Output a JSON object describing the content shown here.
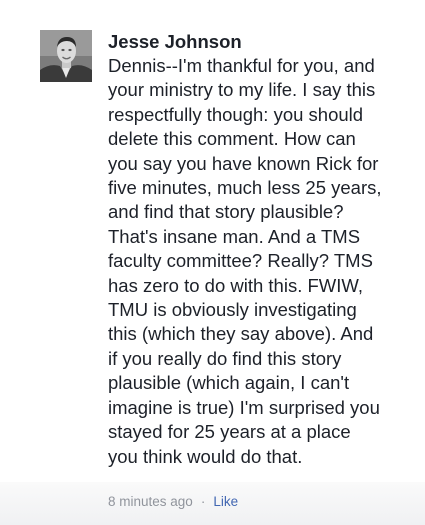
{
  "comment": {
    "author": "Jesse Johnson",
    "body_lines": [
      "Dennis--I'm thankful for you, and",
      "your ministry to my life. I say this",
      "respectfully though: you should",
      "delete this comment. How can",
      "you say you have known Rick for",
      "five minutes, much less 25 years,",
      "and find that story plausible?",
      "That's insane man. And a TMS",
      "faculty committee? Really? TMS",
      "has zero to do with this. FWIW,",
      "TMU is obviously investigating",
      "this (which they say above). And",
      "if you really do find this story",
      "plausible (which again, I can't",
      "imagine is true) I'm surprised you",
      "stayed for 25 years at a place",
      "you think would do that."
    ],
    "timestamp": "8 minutes ago",
    "separator": "·",
    "like_label": "Like"
  },
  "colors": {
    "text": "#1d2129",
    "meta": "#90949c",
    "link": "#4267b2"
  }
}
